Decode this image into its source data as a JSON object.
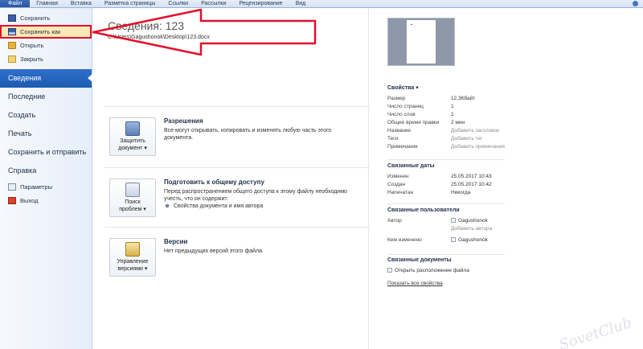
{
  "ribbon": {
    "tabs": [
      "Файл",
      "Главная",
      "Вставка",
      "Разметка страницы",
      "Ссылки",
      "Рассылки",
      "Рецензирование",
      "Вид"
    ]
  },
  "left": {
    "commands_top": [
      {
        "label": "Сохранить",
        "icon": "save-icon"
      },
      {
        "label": "Сохранить как",
        "icon": "save-as-icon"
      },
      {
        "label": "Открыть",
        "icon": "open-folder-icon"
      },
      {
        "label": "Закрыть",
        "icon": "close-doc-icon"
      }
    ],
    "nav": [
      {
        "label": "Сведения",
        "selected": true
      },
      {
        "label": "Последние"
      },
      {
        "label": "Создать"
      },
      {
        "label": "Печать"
      },
      {
        "label": "Сохранить и отправить"
      },
      {
        "label": "Справка"
      }
    ],
    "commands_bottom": [
      {
        "label": "Параметры",
        "icon": "options-icon"
      },
      {
        "label": "Выход",
        "icon": "exit-icon"
      }
    ]
  },
  "main": {
    "title": "Сведения: 123",
    "path": "C:\\Users\\Gagushonok\\Desktop\\123.docx",
    "sections": [
      {
        "button": [
          "Защитить",
          "документ ▾"
        ],
        "heading": "Разрешения",
        "text": "Все могут открывать, копировать и изменять любую часть этого документа."
      },
      {
        "button": [
          "Поиск",
          "проблем ▾"
        ],
        "heading": "Подготовить к общему доступу",
        "text": "Перед распространением общего доступа к этому файлу необходимо учесть, что он содержит:",
        "bullet": "Свойства документа и имя автора"
      },
      {
        "button": [
          "Управление",
          "версиями ▾"
        ],
        "heading": "Версии",
        "text": "Нет предыдущих версий этого файла."
      }
    ]
  },
  "props": {
    "header": "Свойства ▾",
    "rows": [
      {
        "k": "Размер",
        "v": "12,3Кбайт"
      },
      {
        "k": "Число страниц",
        "v": "1"
      },
      {
        "k": "Число слов",
        "v": "1"
      },
      {
        "k": "Общее время правки",
        "v": "2 мин"
      },
      {
        "k": "Название",
        "v": "Добавить заголовок",
        "muted": true
      },
      {
        "k": "Теги",
        "v": "Добавить тег",
        "muted": true
      },
      {
        "k": "Примечания",
        "v": "Добавить примечания",
        "muted": true
      }
    ],
    "dates_header": "Связанные даты",
    "dates": [
      {
        "k": "Изменен",
        "v": "25.05.2017 10:43"
      },
      {
        "k": "Создан",
        "v": "25.05.2017 10:42"
      },
      {
        "k": "Напечатан",
        "v": "Никогда"
      }
    ],
    "people_header": "Связанные пользователи",
    "author_key": "Автор",
    "author_value": "Gagushonok",
    "add_author": "Добавить автора",
    "modified_key": "Кем изменено",
    "modified_value": "Gagushonok",
    "docs_header": "Связанные документы",
    "open_location": "Открыть расположение файла",
    "show_all": "Показать все свойства"
  },
  "watermark": "SovetClub"
}
